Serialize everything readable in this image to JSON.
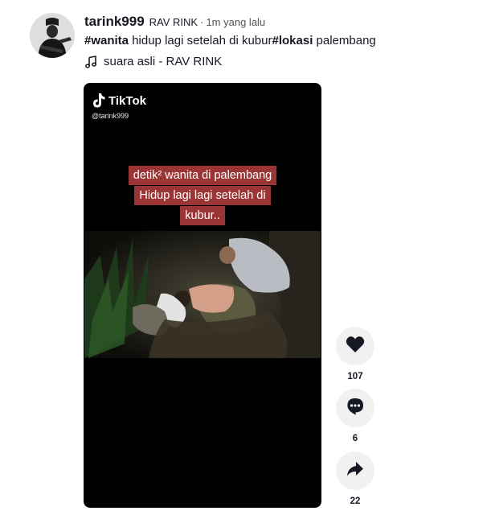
{
  "author": {
    "username": "tarink999",
    "nickname": "RAV RINK",
    "separator": "·",
    "posted": "1m yang lalu"
  },
  "caption": {
    "hashtag1": "#wanita",
    "text1": " hidup lagi setelah di kubur",
    "hashtag2": "#lokasi",
    "text2": " palembang"
  },
  "music": {
    "icon": "music-note-icon",
    "title": "suara asli - RAV RINK"
  },
  "video": {
    "watermark_brand": "TikTok",
    "watermark_user": "@tarink999",
    "overlay_lines": [
      "detik² wanita di palembang",
      "Hidup lagi lagi setelah di",
      "kubur.."
    ],
    "overlay_color": "#9b3535"
  },
  "actions": {
    "like": {
      "icon": "heart-icon",
      "count": "107"
    },
    "comment": {
      "icon": "comment-icon",
      "count": "6"
    },
    "share": {
      "icon": "share-icon",
      "count": "22"
    }
  }
}
